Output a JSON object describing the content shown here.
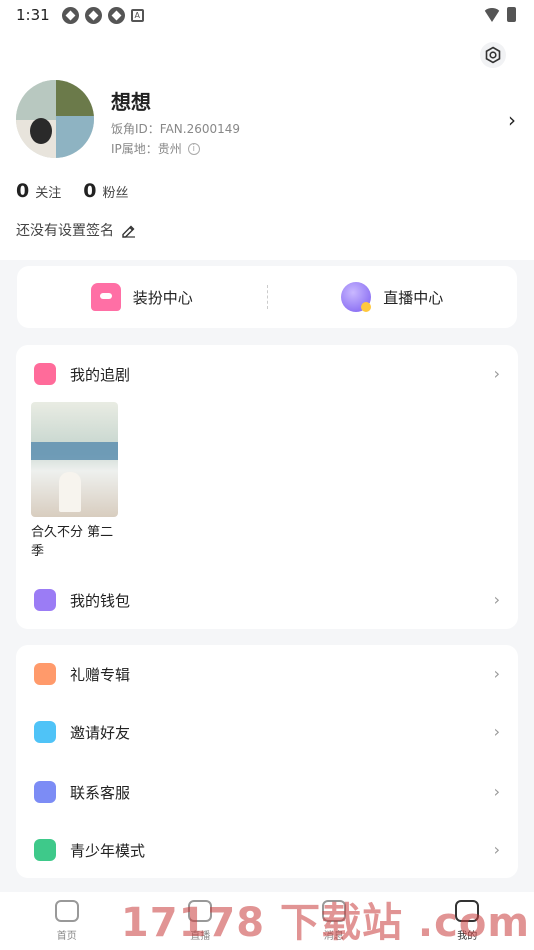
{
  "status": {
    "time": "1:31"
  },
  "profile": {
    "nickname": "想想",
    "fan_id": "饭角ID：FAN.2600149",
    "ip_location": "IP属地：贵州",
    "following_count": "0",
    "following_label": "关注",
    "followers_count": "0",
    "followers_label": "粉丝",
    "signature": "还没有设置签名"
  },
  "quick_actions": [
    {
      "label": "装扮中心",
      "icon": "shirt-icon"
    },
    {
      "label": "直播中心",
      "icon": "planet-icon"
    }
  ],
  "my_dramas": {
    "label": "我的追剧",
    "items": [
      {
        "title": "合久不分 第二季"
      }
    ]
  },
  "wallet": {
    "label": "我的钱包"
  },
  "menu": [
    {
      "label": "礼赠专辑",
      "icon": "gift-icon"
    },
    {
      "label": "邀请好友",
      "icon": "invite-friend-icon"
    },
    {
      "label": "联系客服",
      "icon": "customer-service-icon"
    },
    {
      "label": "青少年模式",
      "icon": "teen-mode-icon"
    }
  ],
  "bottom_nav": [
    {
      "label": "首页",
      "icon": "home-icon"
    },
    {
      "label": "直播",
      "icon": "live-icon"
    },
    {
      "label": "消息",
      "icon": "message-icon"
    },
    {
      "label": "我的",
      "icon": "profile-icon"
    }
  ],
  "watermark": "17178 下载站 .com"
}
